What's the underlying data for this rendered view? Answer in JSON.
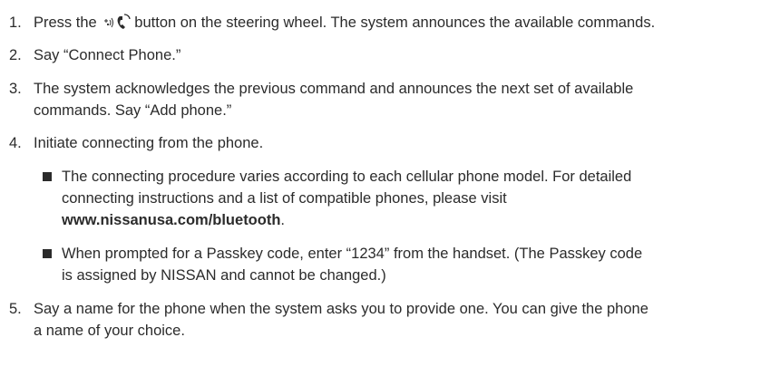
{
  "steps": [
    {
      "number": "1.",
      "before_icon": "Press the",
      "icon": "voice-talk-phone-icon",
      "after_icon": "button on the steering wheel. The system announces the available commands."
    },
    {
      "number": "2.",
      "text": "Say “Connect Phone.”"
    },
    {
      "number": "3.",
      "line1": "The system acknowledges the previous command and announces the next set of available",
      "line2": "commands. Say “Add phone.”"
    },
    {
      "number": "4.",
      "text": "Initiate connecting from the phone.",
      "bullets": [
        {
          "line1": "The connecting procedure varies according to each cellular phone model. For detailed",
          "line2": "connecting instructions and a list of compatible phones, please visit",
          "link": "www.nissanusa.com/bluetooth",
          "after_link": "."
        },
        {
          "line1": "When prompted for a Passkey code, enter “1234” from the handset. (The Passkey code",
          "line2": "is assigned by NISSAN and cannot be changed.)"
        }
      ]
    },
    {
      "number": "5.",
      "line1": "Say a name for the phone when the system asks you to provide one. You can give the phone",
      "line2": "a name of your choice."
    }
  ]
}
